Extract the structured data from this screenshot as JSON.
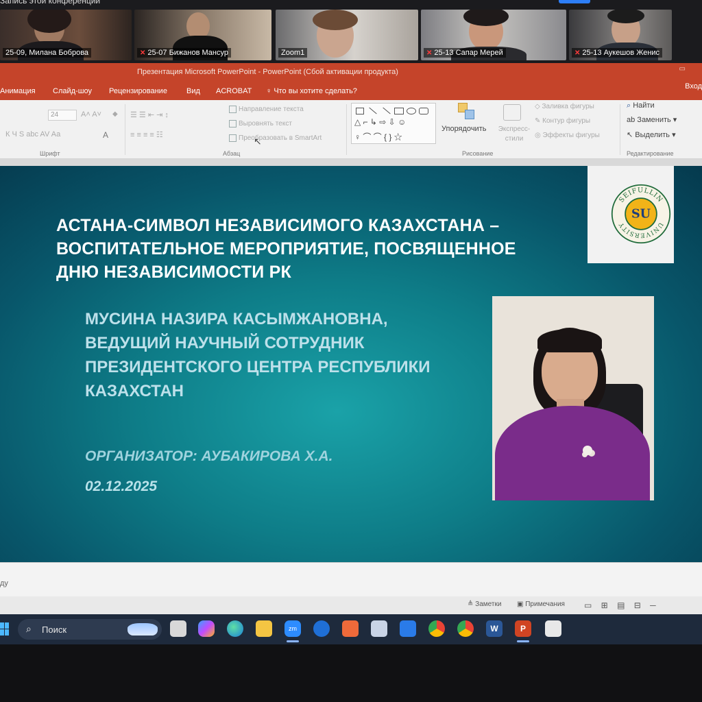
{
  "zoom": {
    "record_notice": "Запись этой конференции",
    "participants": [
      {
        "name": "25-09, Милана Боброва",
        "muted": false
      },
      {
        "name": "25-07 Бижанов Мансур",
        "muted": true
      },
      {
        "name": "Zoom1",
        "muted": false
      },
      {
        "name": "25-13 Сапар Мерей",
        "muted": true
      },
      {
        "name": "25-13 Аукешов Женис",
        "muted": true
      }
    ]
  },
  "powerpoint": {
    "window_title": "Презентация Microsoft PowerPoint - PowerPoint (Сбой активации продукта)",
    "tabs": [
      "Анимация",
      "Слайд-шоу",
      "Рецензирование",
      "Вид",
      "ACROBAT"
    ],
    "tell_me": "Что вы хотите сделать?",
    "signin": "Вход",
    "ribbon": {
      "font_size": "24",
      "text_direction": "Направление текста",
      "align_text": "Выровнять текст",
      "convert_smartart": "Преобразовать в SmartArt",
      "arrange": "Упорядочить",
      "quick_styles": "Экспресс-стили",
      "shape_fill": "Заливка фигуры",
      "shape_outline": "Контур фигуры",
      "shape_effects": "Эффекты фигуры",
      "find": "Найти",
      "replace": "Заменить",
      "select": "Выделить",
      "groups": {
        "font": "Шрифт",
        "paragraph": "Абзац",
        "drawing": "Рисование",
        "editing": "Редактирование"
      }
    },
    "notes_hint": "ду",
    "status": {
      "notes": "Заметки",
      "comments": "Примечания"
    }
  },
  "slide": {
    "title_lines": [
      "АСТАНА-СИМВОЛ НЕЗАВИСИМОГО КАЗАХСТАНА –",
      "ВОСПИТАТЕЛЬНОЕ МЕРОПРИЯТИЕ, ПОСВЯЩЕННОЕ",
      "ДНЮ НЕЗАВИСИМОСТИ РК"
    ],
    "speaker_lines": [
      "МУСИНА НАЗИРА КАСЫМЖАНОВНА,",
      "ВЕДУЩИЙ НАУЧНЫЙ СОТРУДНИК",
      "ПРЕЗИДЕНТСКОГО ЦЕНТРА РЕСПУБЛИКИ",
      "КАЗАХСТАН"
    ],
    "organizer": "ОРГАНИЗАТОР: АУБАКИРОВА Х.А.",
    "date": "02.12.2025",
    "logo": {
      "initials": "SU",
      "arc_text": "SEIFULLIN UNIVERSITY"
    }
  },
  "taskbar": {
    "search_label": "Поиск",
    "apps": [
      "widgets",
      "task-view",
      "copilot",
      "edge",
      "file-explorer",
      "zoom",
      "teamviewer",
      "media-player",
      "store-app",
      "app-blue",
      "chrome",
      "chrome-profile",
      "word",
      "powerpoint",
      "calendar"
    ]
  },
  "colors": {
    "ppt_accent": "#c5442a",
    "slide_teal": "#0e7d88",
    "taskbar": "#1e2a3c",
    "jacket_purple": "#7a2c8a"
  }
}
